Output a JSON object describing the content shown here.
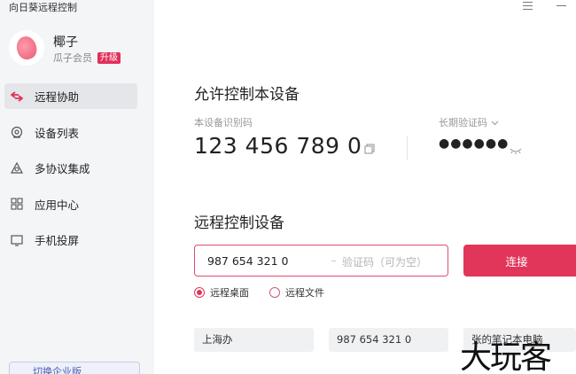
{
  "app": {
    "title": "向日葵远程控制"
  },
  "user": {
    "name": "椰子",
    "membership": "瓜子会员",
    "upgrade": "升级"
  },
  "nav": {
    "items": [
      {
        "label": "远程协助",
        "icon": "remote-assist-icon",
        "active": true
      },
      {
        "label": "设备列表",
        "icon": "device-list-icon"
      },
      {
        "label": "多协议集成",
        "icon": "protocol-icon"
      },
      {
        "label": "应用中心",
        "icon": "app-center-icon"
      },
      {
        "label": "手机投屏",
        "icon": "screen-cast-icon"
      }
    ],
    "enterprise": "切换企业版"
  },
  "allow": {
    "title": "允许控制本设备",
    "id_label": "本设备识别码",
    "device_id": "123 456 789 0",
    "code_label": "长期验证码",
    "code_masked": "●●●●●●"
  },
  "remote": {
    "title": "远程控制设备",
    "id_value": "987 654 321 0",
    "code_placeholder": "验证码（可为空）",
    "connect": "连接",
    "mode_desktop": "远程桌面",
    "mode_file": "远程文件"
  },
  "history": [
    {
      "label": "上海办"
    },
    {
      "label": "987 654 321 0"
    },
    {
      "label": "张的笔记本电脑"
    }
  ],
  "watermark": "大玩客",
  "colors": {
    "accent": "#e1355a",
    "sidebar": "#f4f5f7"
  }
}
